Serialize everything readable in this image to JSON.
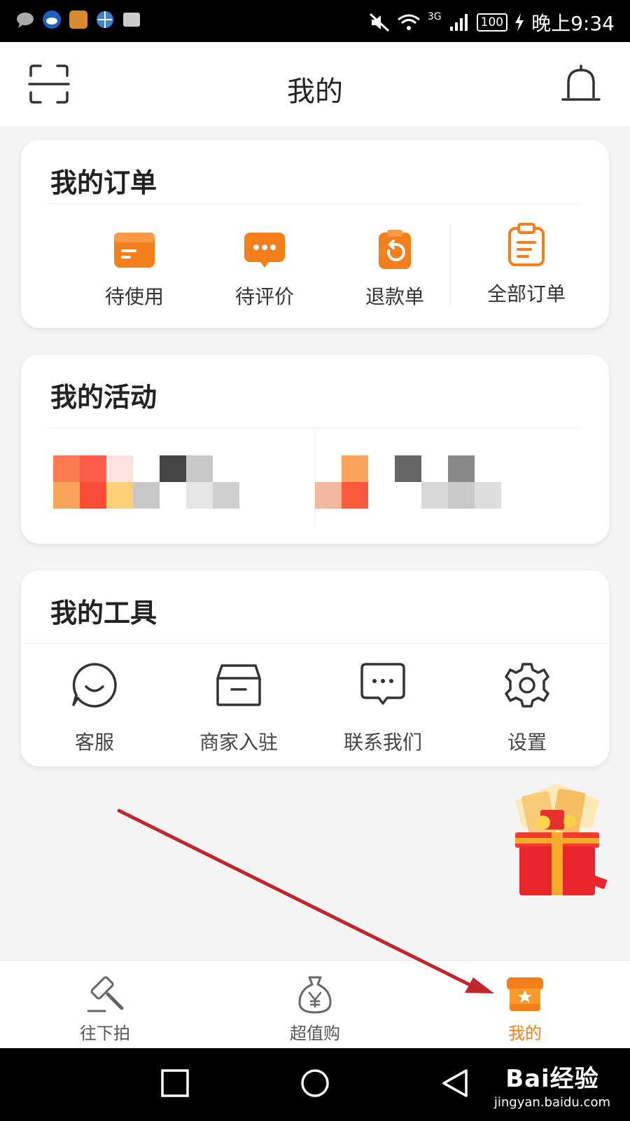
{
  "status_bar": {
    "battery": "100",
    "network": "3G",
    "time": "晚上9:34"
  },
  "header": {
    "title": "我的"
  },
  "orders": {
    "title": "我的订单",
    "items": [
      {
        "label": "待使用",
        "icon": "card-icon"
      },
      {
        "label": "待评价",
        "icon": "comment-icon"
      },
      {
        "label": "退款单",
        "icon": "refund-icon"
      }
    ],
    "all_label": "全部订单"
  },
  "activities": {
    "title": "我的活动"
  },
  "tools": {
    "title": "我的工具",
    "items": [
      {
        "label": "客服",
        "icon": "customer-service-icon"
      },
      {
        "label": "商家入驻",
        "icon": "merchant-box-icon"
      },
      {
        "label": "联系我们",
        "icon": "contact-chat-icon"
      },
      {
        "label": "设置",
        "icon": "settings-gear-icon"
      }
    ]
  },
  "tabbar": {
    "items": [
      {
        "label": "往下拍",
        "icon": "gavel-icon",
        "active": false
      },
      {
        "label": "超值购",
        "icon": "money-bag-icon",
        "active": false
      },
      {
        "label": "我的",
        "icon": "profile-shop-icon",
        "active": true
      }
    ]
  },
  "watermark": {
    "logo": "Bai经验",
    "url": "jingyan.baidu.com"
  },
  "colors": {
    "accent": "#f47e1a",
    "annotation_arrow": "#c0272d"
  }
}
